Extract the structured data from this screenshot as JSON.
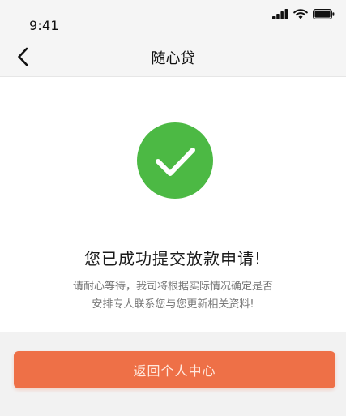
{
  "status_bar": {
    "time": "9:41",
    "icons": [
      "signal-icon",
      "wifi-icon",
      "battery-icon"
    ]
  },
  "nav": {
    "title": "随心贷",
    "back_icon": "chevron-left-icon"
  },
  "result": {
    "icon": "check-circle-icon",
    "icon_color": "#4cb944",
    "headline": "您已成功提交放款申请!",
    "description_line1": "请耐心等待，我司将根据实际情况确定是否",
    "description_line2": "安排专人联系您与您更新相关资料!"
  },
  "action": {
    "button_label": "返回个人中心",
    "button_color": "#ee7047"
  }
}
